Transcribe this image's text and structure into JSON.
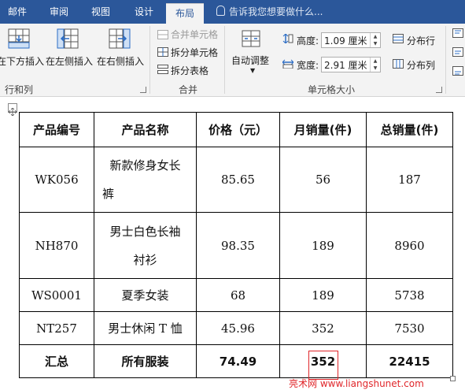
{
  "tabs": [
    "邮件",
    "审阅",
    "视图",
    "设计",
    "布局"
  ],
  "active_tab": "布局",
  "tell_me": "告诉我您想要做什么...",
  "ribbon": {
    "rows_cols": {
      "insert_below": "在下方插入",
      "insert_left": "在左侧插入",
      "insert_right": "在右侧插入",
      "label": "行和列"
    },
    "merge": {
      "merge_cells": "合并单元格",
      "split_cells": "拆分单元格",
      "split_table": "拆分表格",
      "label": "合并"
    },
    "cell_size": {
      "autofit": "自动调整",
      "height_label": "高度:",
      "height_value": "1.09 厘米",
      "width_label": "宽度:",
      "width_value": "2.91 厘米",
      "distribute_rows": "分布行",
      "distribute_cols": "分布列",
      "label": "单元格大小"
    }
  },
  "table": {
    "headers": [
      "产品编号",
      "产品名称",
      "价格（元）",
      "月销量(件)",
      "总销量(件)"
    ],
    "rows": [
      {
        "id": "WK056",
        "name_lines": [
          "新款修身女长",
          "裤"
        ],
        "price": "85.65",
        "monthly": "56",
        "total": "187"
      },
      {
        "id": "NH870",
        "name_lines": [
          "男士白色长袖",
          "衬衫"
        ],
        "price": "98.35",
        "monthly": "189",
        "total": "8960"
      },
      {
        "id": "WS0001",
        "name_lines": [
          "夏季女装"
        ],
        "price": "68",
        "monthly": "189",
        "total": "5738"
      },
      {
        "id": "NT257",
        "name_lines": [
          "男士休闲 T 恤"
        ],
        "price": "45.96",
        "monthly": "352",
        "total": "7530"
      }
    ],
    "summary": {
      "id": "汇总",
      "name": "所有服装",
      "price": "74.49",
      "monthly": "352",
      "total": "22415"
    }
  },
  "watermark": "亮术网 www.liangshunet.com",
  "colors": {
    "ribbon_tab_bar": "#2b579a",
    "ribbon_body": "#f3f3f3",
    "highlight": "#e0262a"
  }
}
